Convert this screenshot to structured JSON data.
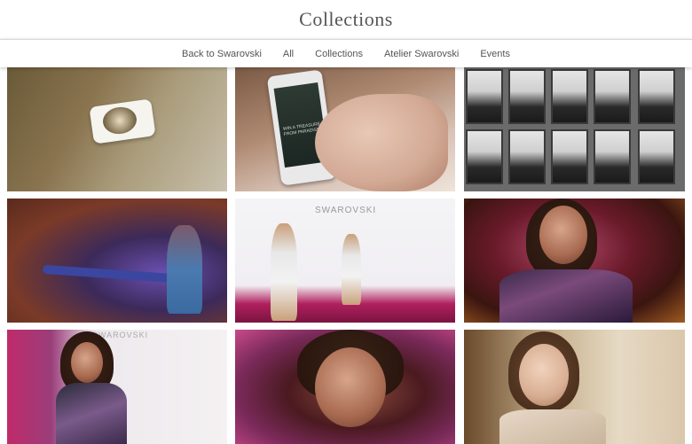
{
  "header": {
    "title": "Collections"
  },
  "nav": {
    "items": [
      {
        "label": "Back to Swarovski"
      },
      {
        "label": "All"
      },
      {
        "label": "Collections"
      },
      {
        "label": "Atelier Swarovski"
      },
      {
        "label": "Events"
      }
    ]
  },
  "gallery": {
    "phone_text": "WIN A TREASURE FROM PARADISE",
    "runway_brand": "SWAROVSKI",
    "runway_brand_partial": "SWAROVSKI"
  }
}
